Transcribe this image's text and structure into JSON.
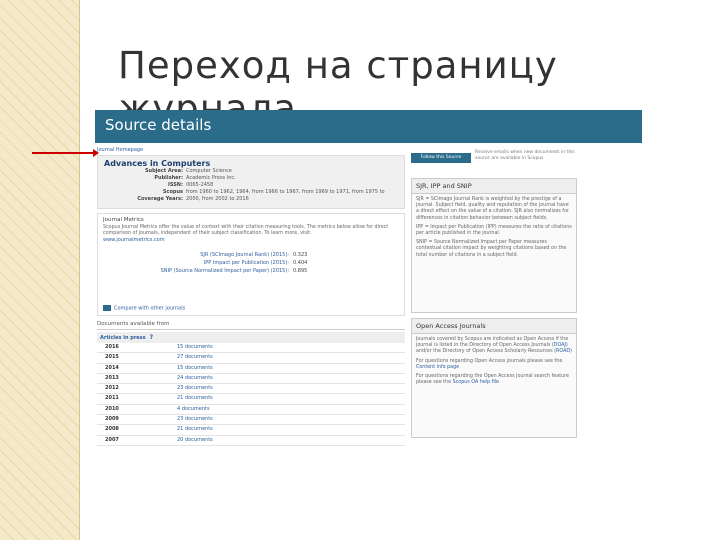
{
  "slide": {
    "title": "Переход на страницу журнала"
  },
  "banner": {
    "title": "Source details"
  },
  "breadcrumb": "Journal Homepage",
  "journal": {
    "title": "Advances in Computers",
    "fields": [
      {
        "k": "Subject Area:",
        "v": "Computer Science"
      },
      {
        "k": "Publisher:",
        "v": "Academic Press Inc."
      },
      {
        "k": "ISSN:",
        "v": "0065-2458"
      },
      {
        "k": "Scopus Coverage Years:",
        "v": "from 1960 to 1962, 1964, from 1966 to 1967, from 1969 to 1971, from 1975 to 2000, from 2002 to 2016"
      }
    ]
  },
  "metrics": {
    "header": "Journal Metrics",
    "description": "Scopus Journal Metrics offer the value of context with their citation measuring tools. The metrics below allow for direct comparison of journals, independent of their subject classification. To learn more, visit:",
    "link": "www.journalmetrics.com",
    "rows": [
      {
        "name": "SJR (SCImago Journal Rank) (2015):",
        "value": "0.323"
      },
      {
        "name": "IPP Impact per Publication (2015):",
        "value": "0.404"
      },
      {
        "name": "SNIP (Source Normalized Impact per Paper) (2015):",
        "value": "0.895"
      }
    ],
    "compare": "Compare with other journals"
  },
  "documents": {
    "header": "Documents available from",
    "filter": "Articles in press",
    "rows": [
      {
        "year": "2016",
        "count": "15 documents"
      },
      {
        "year": "2015",
        "count": "27 documents"
      },
      {
        "year": "2014",
        "count": "15 documents"
      },
      {
        "year": "2013",
        "count": "24 documents"
      },
      {
        "year": "2012",
        "count": "23 documents"
      },
      {
        "year": "2011",
        "count": "21 documents"
      },
      {
        "year": "2010",
        "count": "4 documents"
      },
      {
        "year": "2009",
        "count": "23 documents"
      },
      {
        "year": "2008",
        "count": "21 documents"
      },
      {
        "year": "2007",
        "count": "20 documents"
      }
    ]
  },
  "sidebar": {
    "follow_button": "Follow this Source",
    "follow_note": "Receive emails when new documents in this source are available in Scopus",
    "sjr_panel": {
      "title": "SJR, IPP and SNIP",
      "p1": "SJR = SCImago Journal Rank is weighted by the prestige of a journal. Subject field, quality and reputation of the journal have a direct effect on the value of a citation. SJR also normalizes for differences in citation behavior between subject fields.",
      "p2": "IPP = Impact per Publication (IPP) measures the ratio of citations per article published in the journal.",
      "p3": "SNIP = Source Normalized Impact per Paper measures contextual citation impact by weighting citations based on the total number of citations in a subject field."
    },
    "oa_panel": {
      "title": "Open Access Journals",
      "p1_prefix": "Journals covered by Scopus are indicated as Open Access if the journal is listed in the Directory of Open Access Journals",
      "doaj": "(DOAJ)",
      "p1_mid": "and/or the Directory of Open Access Scholarly Resources",
      "road": "(ROAD)",
      "p2_prefix": "For questions regarding Open Access journals please see the",
      "p2_link": "Content info page",
      "p3_prefix": "For questions regarding the Open Access journal search feature please see the",
      "p3_link": "Scopus OA help file"
    }
  },
  "colors": {
    "banner": "#2b6c8b",
    "link": "#2a5d9f",
    "arrow": "#cc0000"
  },
  "icons": {
    "compare": "chart-icon",
    "help": "help-icon",
    "arrow": "red-arrow"
  }
}
